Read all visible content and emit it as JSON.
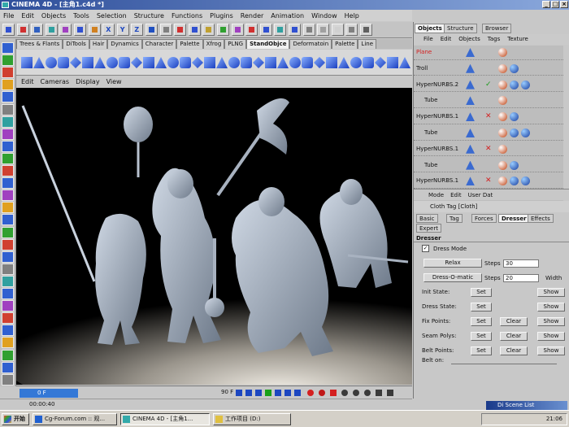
{
  "window": {
    "title": "CINEMA 4D - [主角1.c4d *]"
  },
  "menubar": [
    "File",
    "Edit",
    "Objects",
    "Tools",
    "Selection",
    "Structure",
    "Functions",
    "Plugins",
    "Render",
    "Animation",
    "Window",
    "Help"
  ],
  "main_toolbar_axes": [
    "X",
    "Y",
    "Z"
  ],
  "library_tabs": [
    "Trees & Flants",
    "DiTools",
    "Hair",
    "Dynamics",
    "Character",
    "Palette",
    "Xfrog",
    "PLNG",
    "StandObjce",
    "Deformatoin",
    "Palette",
    "Line"
  ],
  "library_active_tab": "StandObjce",
  "viewport_menu": [
    "Edit",
    "Cameras",
    "Display",
    "View"
  ],
  "timeline": {
    "current_frame": "0 F",
    "end_frame": "90 F"
  },
  "statusbar": {
    "time": "00:00:40"
  },
  "right_tabs": [
    "Objects",
    "Structure",
    "Browser"
  ],
  "right_active_tab": "Objects",
  "object_menu": [
    "File",
    "Edit",
    "Objects",
    "Tags",
    "Texture"
  ],
  "objects": [
    {
      "name": "Plane",
      "indent": 0,
      "selected": true,
      "status": ""
    },
    {
      "name": "Troll",
      "indent": 0,
      "selected": false,
      "status": ""
    },
    {
      "name": "HyperNURBS.2",
      "indent": 0,
      "selected": false,
      "status": "✓"
    },
    {
      "name": "Tube",
      "indent": 1,
      "selected": false,
      "status": ""
    },
    {
      "name": "HyperNURBS.1",
      "indent": 0,
      "selected": false,
      "status": "✕"
    },
    {
      "name": "Tube",
      "indent": 1,
      "selected": false,
      "status": ""
    },
    {
      "name": "HyperNURBS.1",
      "indent": 0,
      "selected": false,
      "status": "✕"
    },
    {
      "name": "Tube",
      "indent": 1,
      "selected": false,
      "status": ""
    },
    {
      "name": "HyperNURBS.1",
      "indent": 0,
      "selected": false,
      "status": "✕"
    }
  ],
  "attr_menu": [
    "Mode",
    "Edit",
    "User Dat"
  ],
  "tag_title": "Cloth Tag [Cloth]",
  "attr_tabs_row1": [
    "Basic",
    "Tag",
    "Forces",
    "Dresser",
    "Effects"
  ],
  "attr_tabs_row2": [
    "Expert"
  ],
  "attr_active_tab": "Dresser",
  "dresser": {
    "heading": "Dresser",
    "dress_mode_label": "Dress Mode",
    "relax_label": "Relax",
    "steps_label": "Steps",
    "relax_steps": "30",
    "dress_o_matic_label": "Dress-O-matic",
    "dress_steps": "20",
    "width_label": "Width",
    "rows": [
      {
        "label": "Init State:",
        "set": "Set",
        "clear": "",
        "show": "Show"
      },
      {
        "label": "Dress State:",
        "set": "Set",
        "clear": "",
        "show": "Show"
      },
      {
        "label": "Fix Points:",
        "set": "Set",
        "clear": "Clear",
        "show": "Show"
      },
      {
        "label": "Seam Polys:",
        "set": "Set",
        "clear": "Clear",
        "show": "Show"
      },
      {
        "label": "Belt Points:",
        "set": "Set",
        "clear": "Clear",
        "show": "Show"
      }
    ],
    "belt_on_label": "Belt on:"
  },
  "taskbar": {
    "start_label": "开始",
    "tasks": [
      "Cg-Forum.com :: 观...",
      "CINEMA 4D - [主角1...",
      "工作项目 (D:)"
    ],
    "active_task": 1,
    "clock": "21:06"
  },
  "scene_list_popup": "Di Scene List"
}
